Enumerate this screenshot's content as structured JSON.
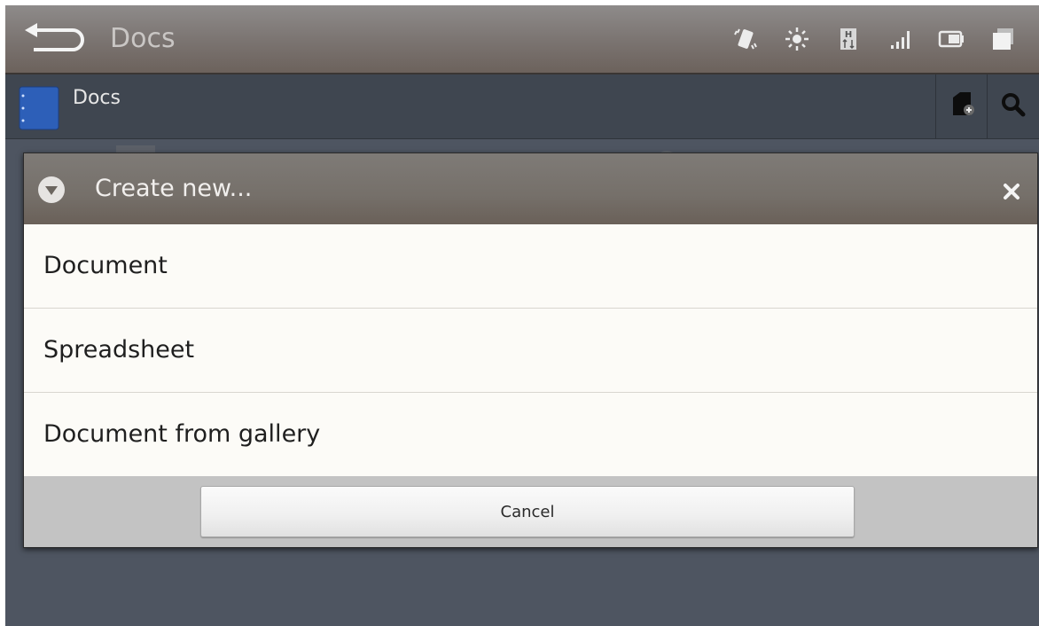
{
  "system_bar": {
    "title": "Docs",
    "icons": [
      "back-arrow-icon",
      "vibrate-icon",
      "brightness-icon",
      "data-transfer-icon",
      "signal-icon",
      "battery-icon",
      "recent-apps-icon"
    ]
  },
  "action_bar": {
    "title": "Docs",
    "actions": [
      "new-document-icon",
      "search-icon"
    ]
  },
  "dialog": {
    "title": "Create new...",
    "options": [
      {
        "label": "Document"
      },
      {
        "label": "Spreadsheet"
      },
      {
        "label": "Document from gallery"
      }
    ],
    "cancel_label": "Cancel"
  },
  "colors": {
    "screen_bg": "#4e5561",
    "dialog_bg": "#fcfbf7",
    "footer_bg": "#c3c3c3"
  }
}
